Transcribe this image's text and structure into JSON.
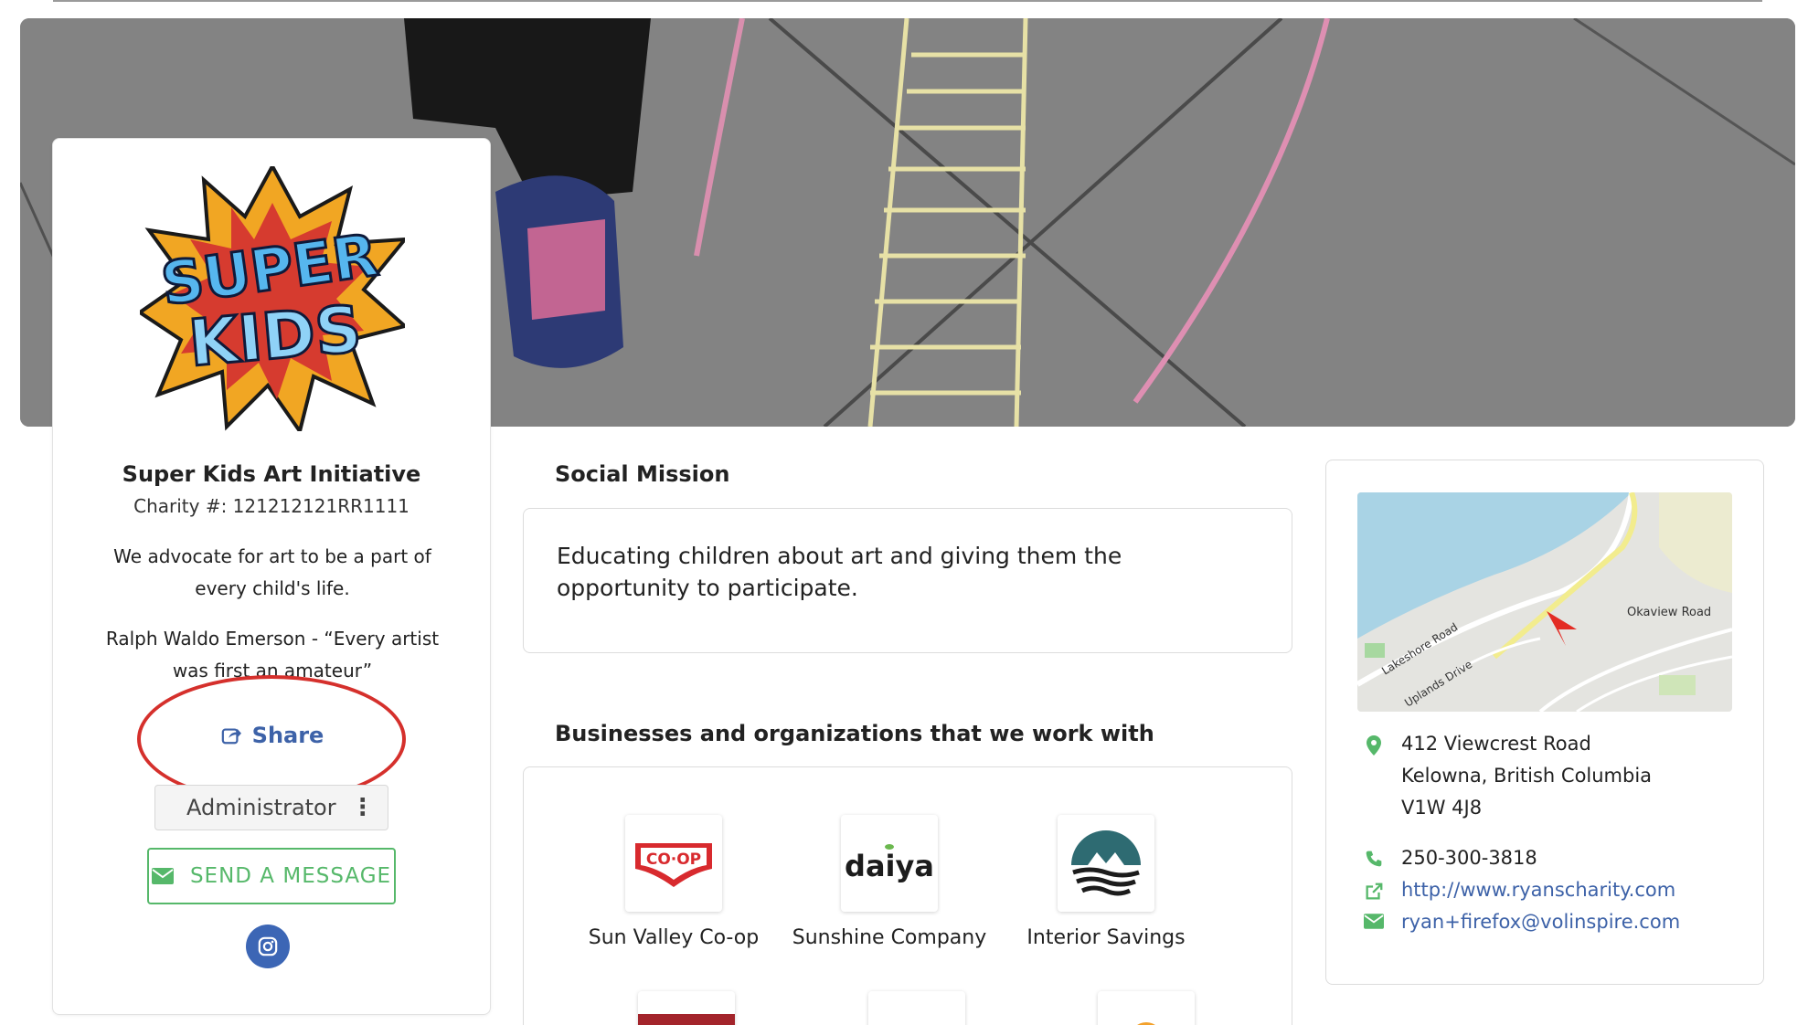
{
  "banner": {
    "alt": ""
  },
  "organization": {
    "name": "Super Kids Art Initiative",
    "charity_number": "Charity #: 121212121RR1111",
    "description": "We advocate for art to be a part of every child's life.",
    "quote": "Ralph Waldo Emerson - “Every artist was first an amateur”",
    "logo_text_line1": "SUPER",
    "logo_text_line2": "KIDS"
  },
  "actions": {
    "share_label": "Share",
    "role_label": "Administrator",
    "send_message_label": "SEND A MESSAGE"
  },
  "mission": {
    "title": "Social Mission",
    "text": "Educating children about art and giving them the opportunity to participate."
  },
  "businesses": {
    "title": "Businesses and organizations that we work with",
    "items": [
      {
        "name": "Sun Valley Co-op",
        "logo_text": "CO·OP"
      },
      {
        "name": "Sunshine Company",
        "logo_text": "daiya"
      },
      {
        "name": "Interior Savings",
        "logo_text": ""
      }
    ]
  },
  "contact": {
    "map_labels": {
      "road1": "Okaview Road",
      "road2": "Lakeshore Road",
      "road3": "Uplands Drive"
    },
    "address_line1": "412 Viewcrest Road",
    "address_line2": "Kelowna, British Columbia",
    "address_line3": "V1W 4J8",
    "phone": "250-300-3818",
    "website": "http://www.ryanscharity.com",
    "email": "ryan+firefox@volinspire.com"
  },
  "colors": {
    "link_blue": "#3d62a8",
    "send_green": "#56b86a",
    "annotation_red": "#d5302c",
    "instagram_blue": "#3c66b5"
  }
}
